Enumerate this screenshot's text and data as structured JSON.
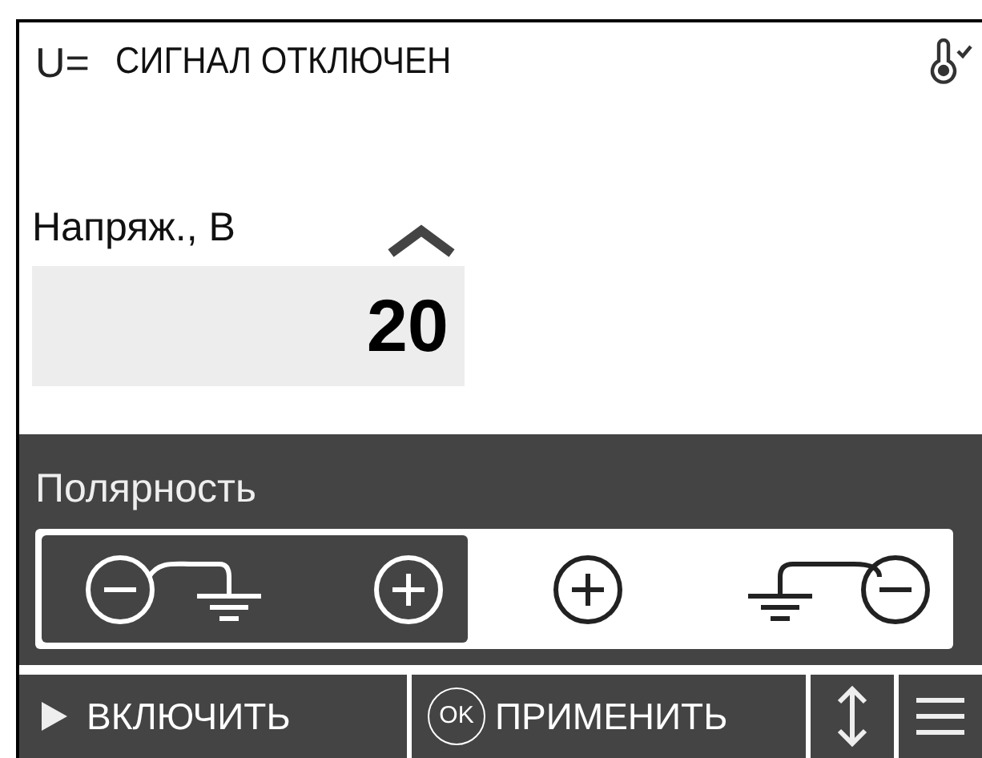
{
  "header": {
    "mode": "U=",
    "status": "СИГНАЛ ОТКЛЮЧЕН"
  },
  "voltage": {
    "label": "Напряж., В",
    "value": "20"
  },
  "polarity": {
    "label": "Полярность",
    "options": [
      {
        "kind": "negative_grounded",
        "selected": true
      },
      {
        "kind": "positive",
        "selected": false
      },
      {
        "kind": "ground_negative",
        "selected": false
      }
    ]
  },
  "toolbar": {
    "enable": "ВКЛЮЧИТЬ",
    "apply_badge": "OK",
    "apply": "ПРИМЕНИТЬ"
  }
}
